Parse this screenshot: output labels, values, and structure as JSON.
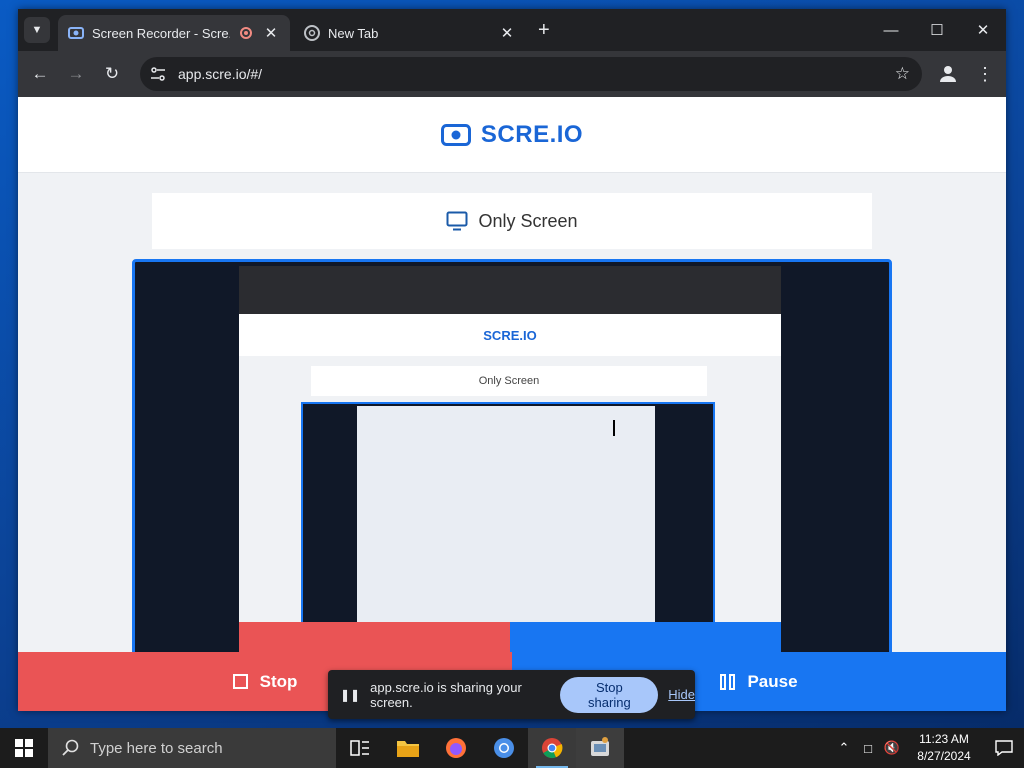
{
  "browser": {
    "tabs": [
      {
        "title": "Screen Recorder - Scre.io",
        "active": true,
        "recording": true
      },
      {
        "title": "New Tab",
        "active": false
      }
    ],
    "new_tab_label": "+",
    "url": "app.scre.io/#/",
    "window_controls": {
      "minimize": "—",
      "maximize": "☐",
      "close": "✕"
    }
  },
  "page": {
    "logo_text": "SCRE.IO",
    "mode_label": "Only Screen",
    "preview": {
      "logo_text": "SCRE.IO",
      "mode_label": "Only Screen"
    },
    "controls": {
      "stop_label": "Stop",
      "pause_label": "Pause"
    }
  },
  "share_notice": {
    "message": "app.scre.io is sharing your screen.",
    "stop_label": "Stop sharing",
    "hide_label": "Hide"
  },
  "taskbar": {
    "search_placeholder": "Type here to search",
    "time": "11:23 AM",
    "date": "8/27/2024",
    "apps": [
      "task-view",
      "file-explorer",
      "firefox",
      "chromium",
      "chrome",
      "app"
    ]
  },
  "colors": {
    "stop_red": "#ea5455",
    "pause_blue": "#1876f2",
    "brand_blue": "#1a66d6",
    "chrome_dark": "#202124"
  }
}
